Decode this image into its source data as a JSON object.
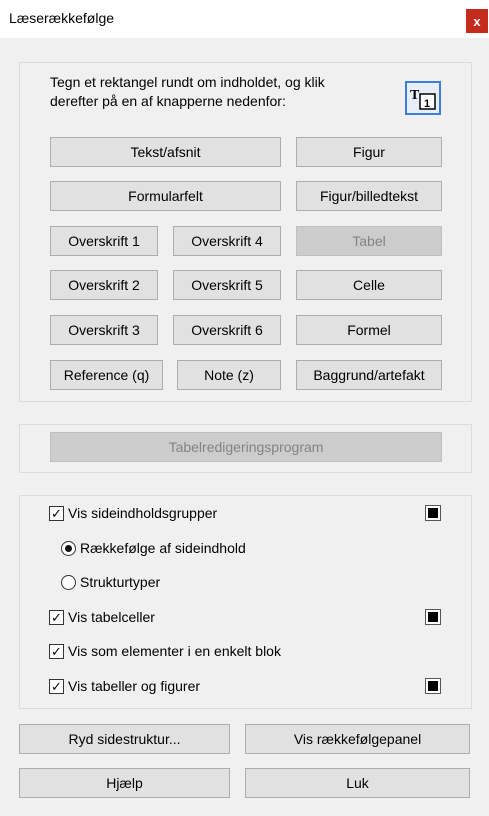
{
  "window": {
    "title": "Læserækkefølge",
    "close_glyph": "x"
  },
  "instructions": "Tegn et rektangel rundt om indholdet, og klik derefter på en af knapperne nedenfor:",
  "tool_icon": {
    "name": "draw-rectangle-tool-icon",
    "letter": "T",
    "digit": "1"
  },
  "buttons": {
    "tekst_afsnit": "Tekst/afsnit",
    "figur": "Figur",
    "formularfelt": "Formularfelt",
    "figur_billedtekst": "Figur/billedtekst",
    "overskrift1": "Overskrift 1",
    "overskrift2": "Overskrift 2",
    "overskrift3": "Overskrift 3",
    "overskrift4": "Overskrift 4",
    "overskrift5": "Overskrift 5",
    "overskrift6": "Overskrift 6",
    "tabel": "Tabel",
    "celle": "Celle",
    "formel": "Formel",
    "reference": "Reference (q)",
    "note": "Note (z)",
    "baggrund": "Baggrund/artefakt"
  },
  "table_editor": "Tabelredigeringsprogram",
  "options": {
    "vis_sideindholdsgrupper": {
      "label": "Vis sideindholdsgrupper",
      "checked": true,
      "color": "#000000"
    },
    "raekkefolge": {
      "label": "Rækkefølge af sideindhold",
      "selected": true
    },
    "strukturtyper": {
      "label": "Strukturtyper",
      "selected": false
    },
    "vis_tabelceller": {
      "label": "Vis tabelceller",
      "checked": true,
      "color": "#000000"
    },
    "vis_som_elementer": {
      "label": "Vis som elementer i en enkelt blok",
      "checked": true
    },
    "vis_tabeller_figurer": {
      "label": "Vis tabeller og figurer",
      "checked": true,
      "color": "#000000"
    }
  },
  "footer": {
    "ryd": "Ryd sidestruktur...",
    "vis_panel": "Vis rækkefølgepanel",
    "hjaelp": "Hjælp",
    "luk": "Luk"
  },
  "colors": {
    "close_red": "#c42b1c",
    "panel_bg": "#f0f0f0",
    "button_bg": "#e1e1e1",
    "icon_border": "#3c7fd6"
  }
}
